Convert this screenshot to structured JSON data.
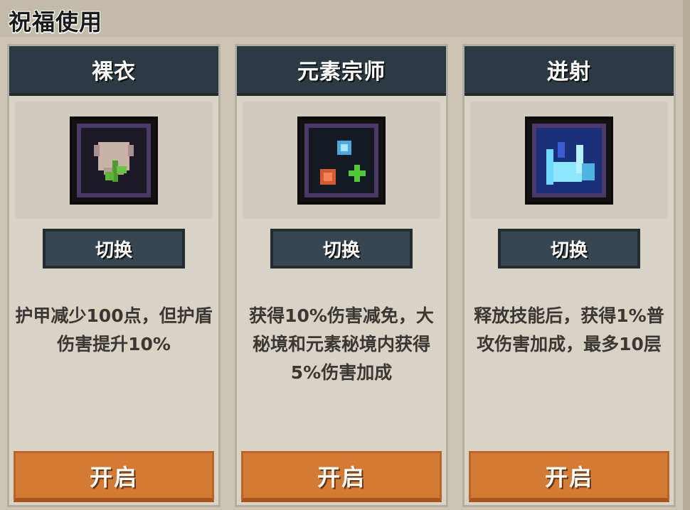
{
  "header": {
    "title": "祝福使用"
  },
  "cards": [
    {
      "name": "裸衣",
      "icon": "naked-armor-icon",
      "switch_label": "切换",
      "description": "护甲减少100点，但护盾伤害提升10%",
      "open_label": "开启"
    },
    {
      "name": "元素宗师",
      "icon": "element-master-icon",
      "switch_label": "切换",
      "description": "获得10%伤害减免，大秘境和元素秘境内获得5%伤害加成",
      "open_label": "开启"
    },
    {
      "name": "迸射",
      "icon": "burst-icon",
      "switch_label": "切换",
      "description": "释放技能后，获得1%普攻伤害加成，最多10层",
      "open_label": "开启"
    }
  ],
  "colors": {
    "header_bg": "#2c3a44",
    "open_button": "#d37a34",
    "switch_button": "#364652"
  }
}
